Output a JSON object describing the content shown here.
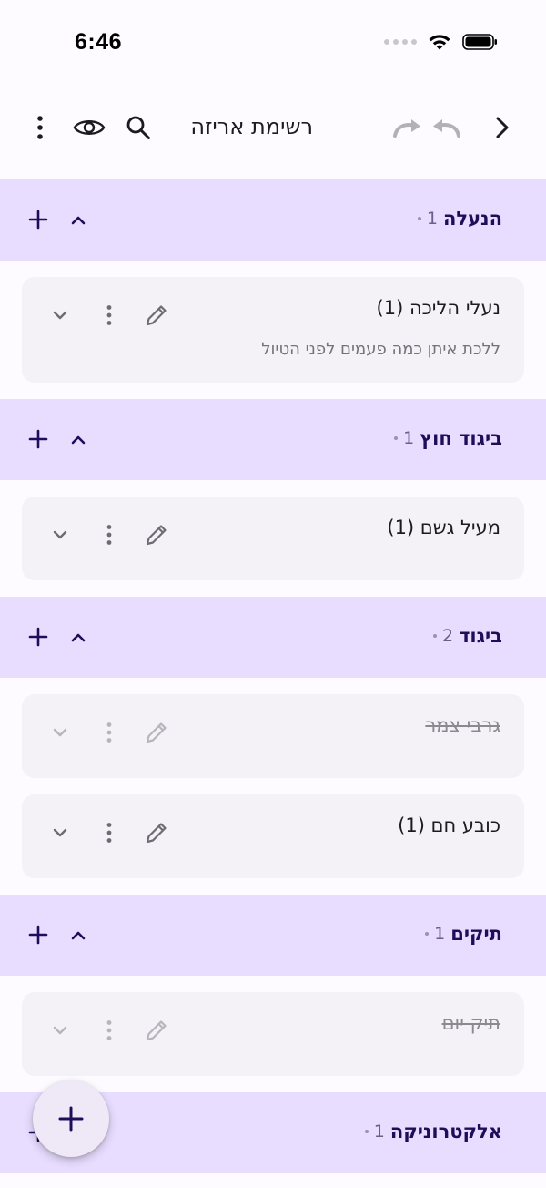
{
  "status_bar": {
    "time": "6:46"
  },
  "toolbar": {
    "title": "רשימת אריזה",
    "icons": [
      "chevron-right-icon",
      "undo-icon",
      "redo-icon",
      "search-icon",
      "eye-icon",
      "more-vert-icon"
    ]
  },
  "colors": {
    "category_bg": "#e8ddff",
    "category_text": "#1e0e5a",
    "item_bg": "#f4f1f7",
    "accent": "#1e0e5a"
  },
  "categories": [
    {
      "name": "הנעלה",
      "count": "1",
      "items": [
        {
          "name": "נעלי הליכה (1)",
          "note": "ללכת איתן כמה פעמים לפני הטיול"
        }
      ]
    },
    {
      "name": "ביגוד חוץ",
      "count": "1",
      "items": [
        {
          "name": "מעיל גשם (1)"
        }
      ]
    },
    {
      "name": "ביגוד",
      "count": "2",
      "items": [
        {
          "name": "גרבי צמר",
          "done": true
        },
        {
          "name": "כובע חם (1)"
        }
      ]
    },
    {
      "name": "תיקים",
      "count": "1",
      "items": [
        {
          "name": "תיק יום",
          "done": true
        }
      ]
    },
    {
      "name": "אלקטרוניקה",
      "count": "1",
      "items": []
    }
  ]
}
